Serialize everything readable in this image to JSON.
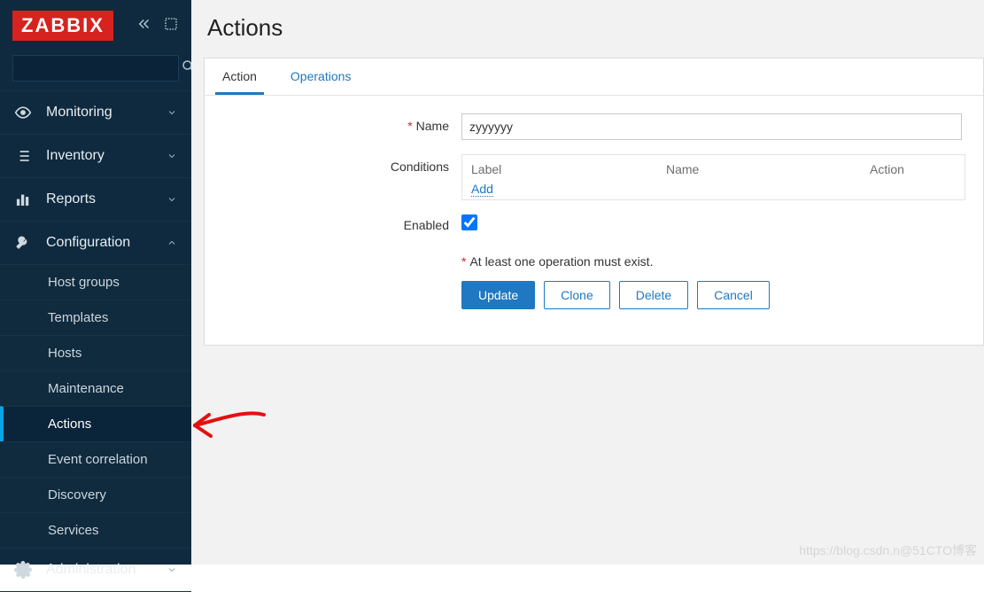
{
  "brand": "ZABBIX",
  "search": {
    "placeholder": ""
  },
  "nav": {
    "monitoring": "Monitoring",
    "inventory": "Inventory",
    "reports": "Reports",
    "configuration": "Configuration",
    "administration": "Administration"
  },
  "config_sub": {
    "host_groups": "Host groups",
    "templates": "Templates",
    "hosts": "Hosts",
    "maintenance": "Maintenance",
    "actions": "Actions",
    "event_correlation": "Event correlation",
    "discovery": "Discovery",
    "services": "Services"
  },
  "page": {
    "title": "Actions",
    "tabs": {
      "action": "Action",
      "operations": "Operations"
    },
    "form": {
      "name_label": "Name",
      "name_value": "zyyyyyy",
      "conditions_label": "Conditions",
      "cond_col_label": "Label",
      "cond_col_name": "Name",
      "cond_col_action": "Action",
      "add_link": "Add",
      "enabled_label": "Enabled",
      "enabled_checked": true,
      "hint": "At least one operation must exist.",
      "buttons": {
        "update": "Update",
        "clone": "Clone",
        "delete": "Delete",
        "cancel": "Cancel"
      }
    }
  },
  "watermark": "https://blog.csdn.n@51CTO博客"
}
